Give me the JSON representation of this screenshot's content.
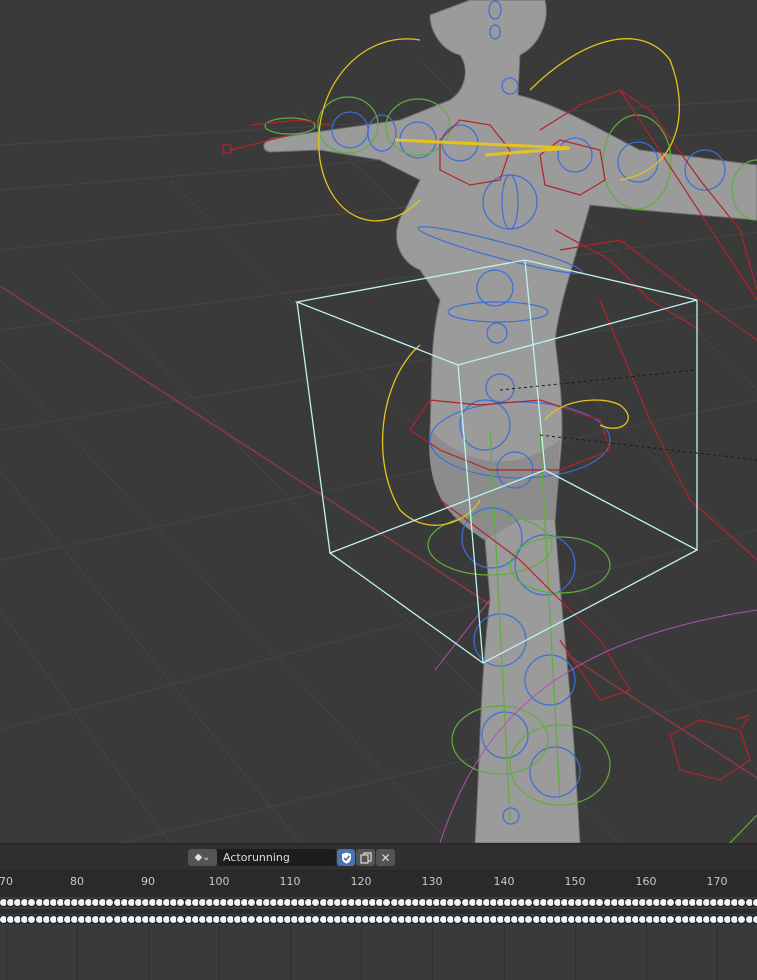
{
  "viewport": {
    "name": "3D Viewport",
    "colors": {
      "background": "#3a3a3a",
      "grid": "#474747",
      "x_axis": "#8a3c42",
      "selection_box": "#bff2f2",
      "bone_blue": "#3b6fd6",
      "bone_green": "#5fae3c",
      "bone_red": "#b3232b",
      "bone_yellow": "#e6c21e"
    }
  },
  "action_editor": {
    "mode_icon": "action-editor-mode-icon",
    "action_name": "Actorunning",
    "fake_user_icon": "shield-check-icon",
    "new_action_icon": "duplicate-icon",
    "unlink_icon": "close-icon",
    "unlink_glyph": "✕",
    "mode_glyph": "◆⌄"
  },
  "timeline": {
    "frame_labels": [
      "70",
      "80",
      "90",
      "100",
      "110",
      "120",
      "130",
      "140",
      "150",
      "160",
      "170"
    ]
  }
}
